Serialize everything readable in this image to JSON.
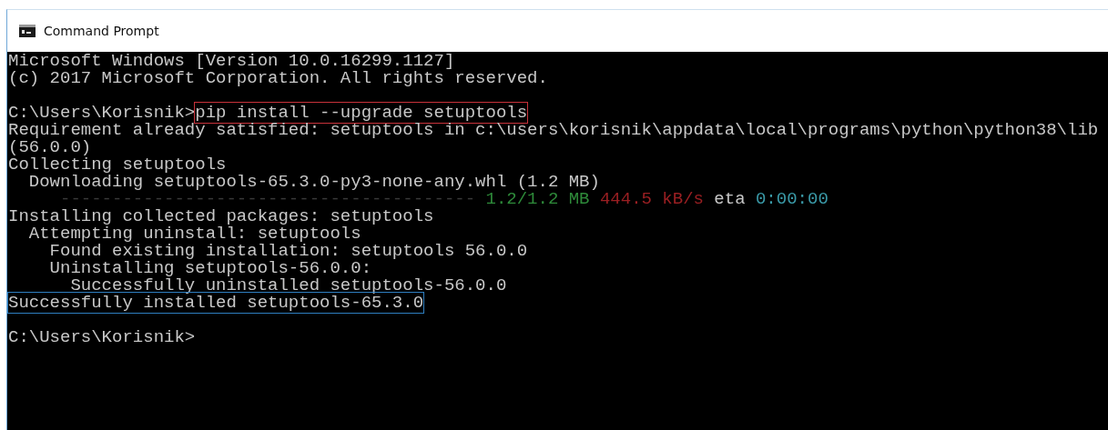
{
  "window": {
    "title": "Command Prompt"
  },
  "console": {
    "lines": [
      {
        "segments": [
          {
            "text": "Microsoft Windows [Version 10.0.16299.1127]"
          }
        ]
      },
      {
        "segments": [
          {
            "text": "(c) 2017 Microsoft Corporation. All rights reserved."
          }
        ]
      },
      {
        "kind": "blank"
      },
      {
        "segments": [
          {
            "text": "C:\\Users\\Korisnik>"
          },
          {
            "text": "pip install --upgrade setuptools",
            "kind": "framed",
            "color": "#c8323a"
          }
        ]
      },
      {
        "segments": [
          {
            "text": "Requirement already satisfied: setuptools in c:\\users\\korisnik\\appdata\\local\\programs\\python\\python38\\lib"
          }
        ]
      },
      {
        "segments": [
          {
            "text": "(56.0.0)"
          }
        ]
      },
      {
        "segments": [
          {
            "text": "Collecting setuptools"
          }
        ]
      },
      {
        "segments": [
          {
            "text": "  Downloading setuptools-65.3.0-py3-none-any.whl (1.2 MB)"
          }
        ]
      },
      {
        "segments": [
          {
            "text": "     ---------------------------------------- ",
            "kind": "colored",
            "color": "#3a3a3a"
          },
          {
            "text": "1.2/1.2 MB ",
            "kind": "colored",
            "color": "#2e8b3a"
          },
          {
            "text": "444.5 kB/s",
            "kind": "colored",
            "color": "#9a1f22"
          },
          {
            "text": " eta "
          },
          {
            "text": "0:00:00",
            "kind": "colored",
            "color": "#3a9aa8"
          }
        ]
      },
      {
        "segments": [
          {
            "text": "Installing collected packages: setuptools"
          }
        ]
      },
      {
        "segments": [
          {
            "text": "  Attempting uninstall: setuptools"
          }
        ]
      },
      {
        "segments": [
          {
            "text": "    Found existing installation: setuptools 56.0.0"
          }
        ]
      },
      {
        "segments": [
          {
            "text": "    Uninstalling setuptools-56.0.0:"
          }
        ]
      },
      {
        "segments": [
          {
            "text": "      Successfully uninstalled setuptools-56.0.0"
          }
        ]
      },
      {
        "segments": [
          {
            "text": "Successfully installed setuptools-65.3.0",
            "kind": "framed",
            "color": "#2f7fc1"
          }
        ]
      },
      {
        "kind": "blank"
      },
      {
        "segments": [
          {
            "text": "C:\\Users\\Korisnik>"
          }
        ]
      }
    ]
  }
}
